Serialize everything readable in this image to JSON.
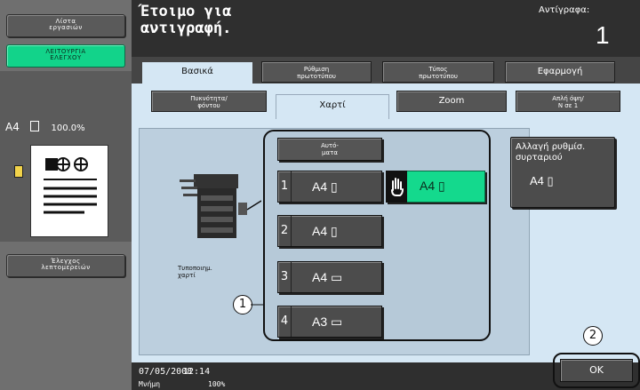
{
  "sidebar": {
    "job_list_label": "Λίστα\nεργασιών",
    "utility_label": "ΛΕΙΤΟΥΡΓΙΑ\nΕΛΕΓΧΟΥ",
    "preview": {
      "paper": "A4",
      "zoom": "100.0%"
    },
    "detail_check_label": "Έλεγχος\nλεπτομερειών"
  },
  "header": {
    "title": "Έτοιμο για\nαντιγραφή.",
    "copies_label": "Αντίγραφα:",
    "copies_value": "1"
  },
  "tabs": {
    "basic": "Βασικά",
    "original_setting": "Ρύθμιση\nπρωτοτύπου",
    "original_type": "Τύπος\nπρωτοτύπου",
    "application": "Εφαρμογή"
  },
  "subtabs": {
    "density": "Πυκνότητα/\nφόντου",
    "paper": "Χαρτί",
    "zoom": "Zoom",
    "duplex": "Απλή όψη/\nΝ σε 1"
  },
  "paper_panel": {
    "auto_label": "Αυτό-\nματα",
    "trays": [
      {
        "num": "1",
        "size": "A4 ▯"
      },
      {
        "num": "2",
        "size": "A4 ▯"
      },
      {
        "num": "3",
        "size": "A4 ▭"
      },
      {
        "num": "4",
        "size": "A3 ▭"
      }
    ],
    "bypass_size": "A4 ▯",
    "printer_label": "Τυποποιημ.\nχαρτί"
  },
  "change_setting": {
    "label": "Αλλαγή ρυθμίσ.\nσυρταριού",
    "value": "A4 ▯"
  },
  "footer": {
    "date": "07/05/2008",
    "time": "12:14",
    "memory_label": "Μνήμη",
    "memory_value": "100%",
    "ok_label": "OK"
  },
  "callouts": [
    "1",
    "2"
  ],
  "colors": {
    "accent": "#12d38a",
    "panel": "#d5e7f4",
    "dark": "#2f2f2f"
  }
}
